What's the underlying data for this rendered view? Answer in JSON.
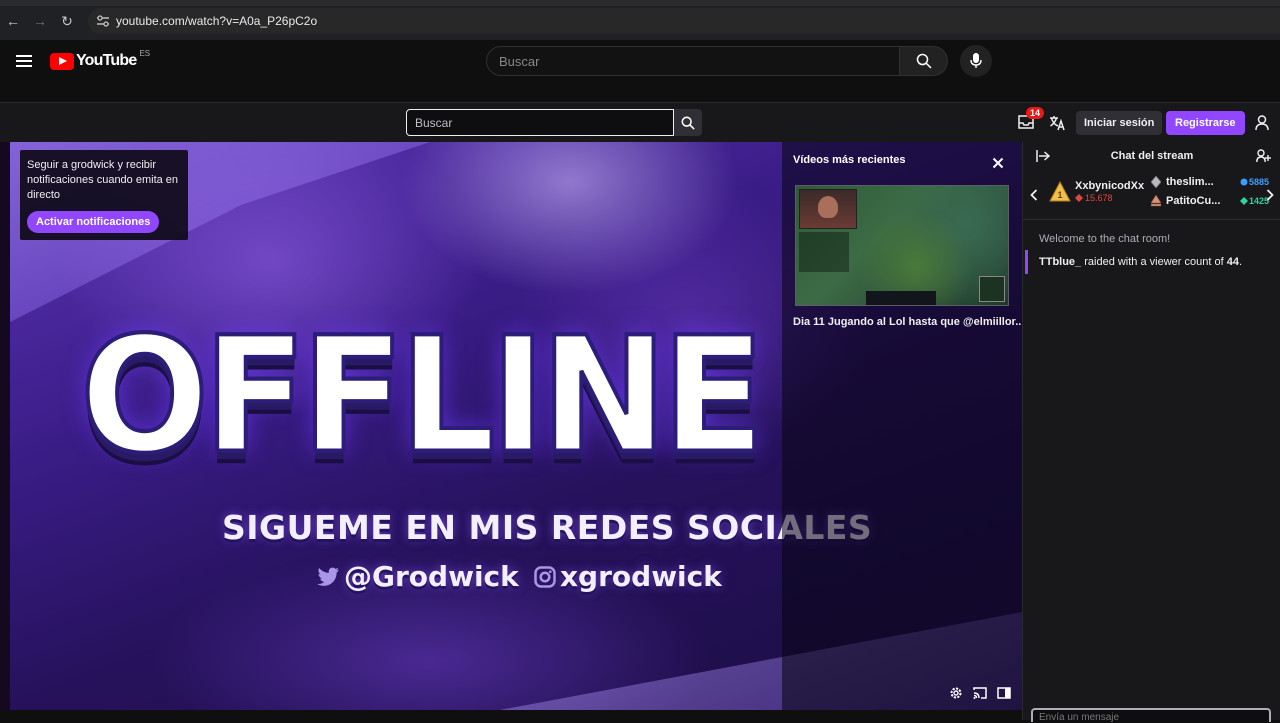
{
  "browser": {
    "url": "youtube.com/watch?v=A0a_P26pC2o"
  },
  "youtube": {
    "logo_text": "YouTube",
    "country_code": "ES",
    "search_placeholder": "Buscar"
  },
  "twitch": {
    "search_placeholder": "Buscar",
    "inbox_count": "14",
    "login_label": "Iniciar sesión",
    "register_label": "Registrarse",
    "accent_color": "#9147ff"
  },
  "player": {
    "notify_text": "Seguir a grodwick y recibir notificaciones cuando emita en directo",
    "notify_button": "Activar notificaciones",
    "offline_text": "OFFLINE",
    "social_title": "SIGUEME EN MIS REDES SOCIALES",
    "twitter_handle": "@Grodwick",
    "instagram_handle": "xgrodwick",
    "recent_title": "Vídeos más recientes",
    "recent_caption": "Dia 11 Jugando al Lol hasta que @elmiillor..."
  },
  "chat": {
    "title": "Chat del stream",
    "leaderboard": {
      "top": {
        "name": "XxbynicodXx",
        "score": "15.678"
      },
      "rows": [
        {
          "name": "theslim...",
          "points": "5885",
          "color": "#3d9dff"
        },
        {
          "name": "PatitoCu...",
          "points": "1425",
          "color": "#2ed3a0"
        }
      ]
    },
    "welcome": "Welcome to the chat room!",
    "raid_user": "TTblue_",
    "raid_text": " raided with a viewer count of ",
    "raid_count": "44",
    "raid_end": ".",
    "input_placeholder": "Envía un mensaje"
  }
}
